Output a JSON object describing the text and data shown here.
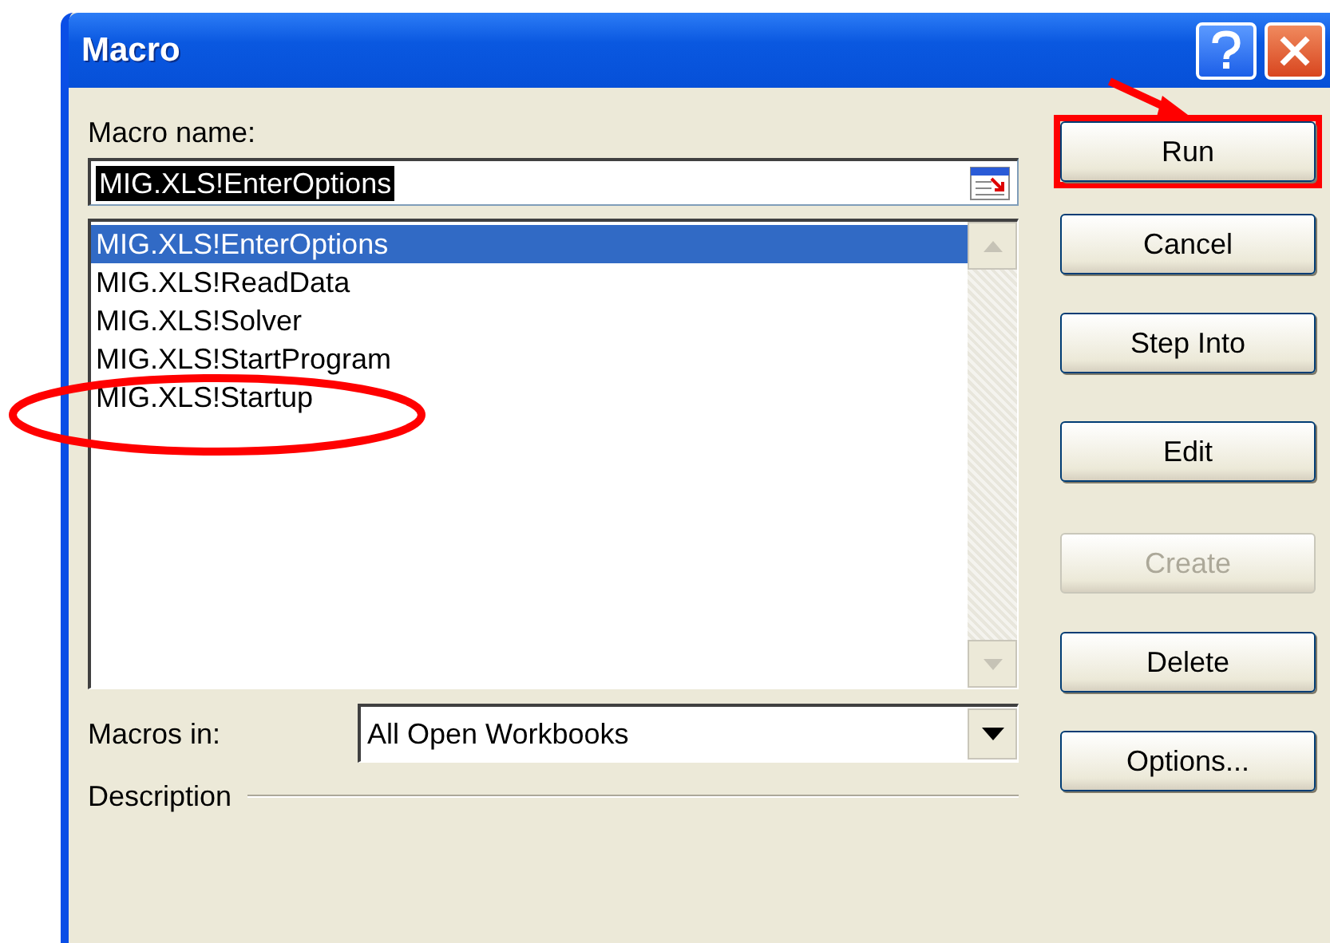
{
  "window": {
    "title": "Macro"
  },
  "macro_name": {
    "label": "Macro name:",
    "value": "MIG.XLS!EnterOptions",
    "text_selected": true
  },
  "macros": [
    {
      "name": "MIG.XLS!EnterOptions",
      "selected": true,
      "circled": false
    },
    {
      "name": "MIG.XLS!ReadData",
      "selected": false,
      "circled": false
    },
    {
      "name": "MIG.XLS!Solver",
      "selected": false,
      "circled": false
    },
    {
      "name": "MIG.XLS!StartProgram",
      "selected": false,
      "circled": false
    },
    {
      "name": "MIG.XLS!Startup",
      "selected": false,
      "circled": true
    }
  ],
  "buttons": [
    {
      "label": "Run",
      "disabled": false,
      "highlighted": true
    },
    {
      "label": "Cancel",
      "disabled": false,
      "highlighted": false
    },
    {
      "label": "Step Into",
      "disabled": false,
      "highlighted": false
    },
    {
      "label": "Edit",
      "disabled": false,
      "highlighted": false
    },
    {
      "label": "Create",
      "disabled": true,
      "highlighted": false
    },
    {
      "label": "Delete",
      "disabled": false,
      "highlighted": false
    },
    {
      "label": "Options...",
      "disabled": false,
      "highlighted": false
    }
  ],
  "macros_in": {
    "label": "Macros in:",
    "value": "All Open Workbooks"
  },
  "description": {
    "label": "Description"
  }
}
